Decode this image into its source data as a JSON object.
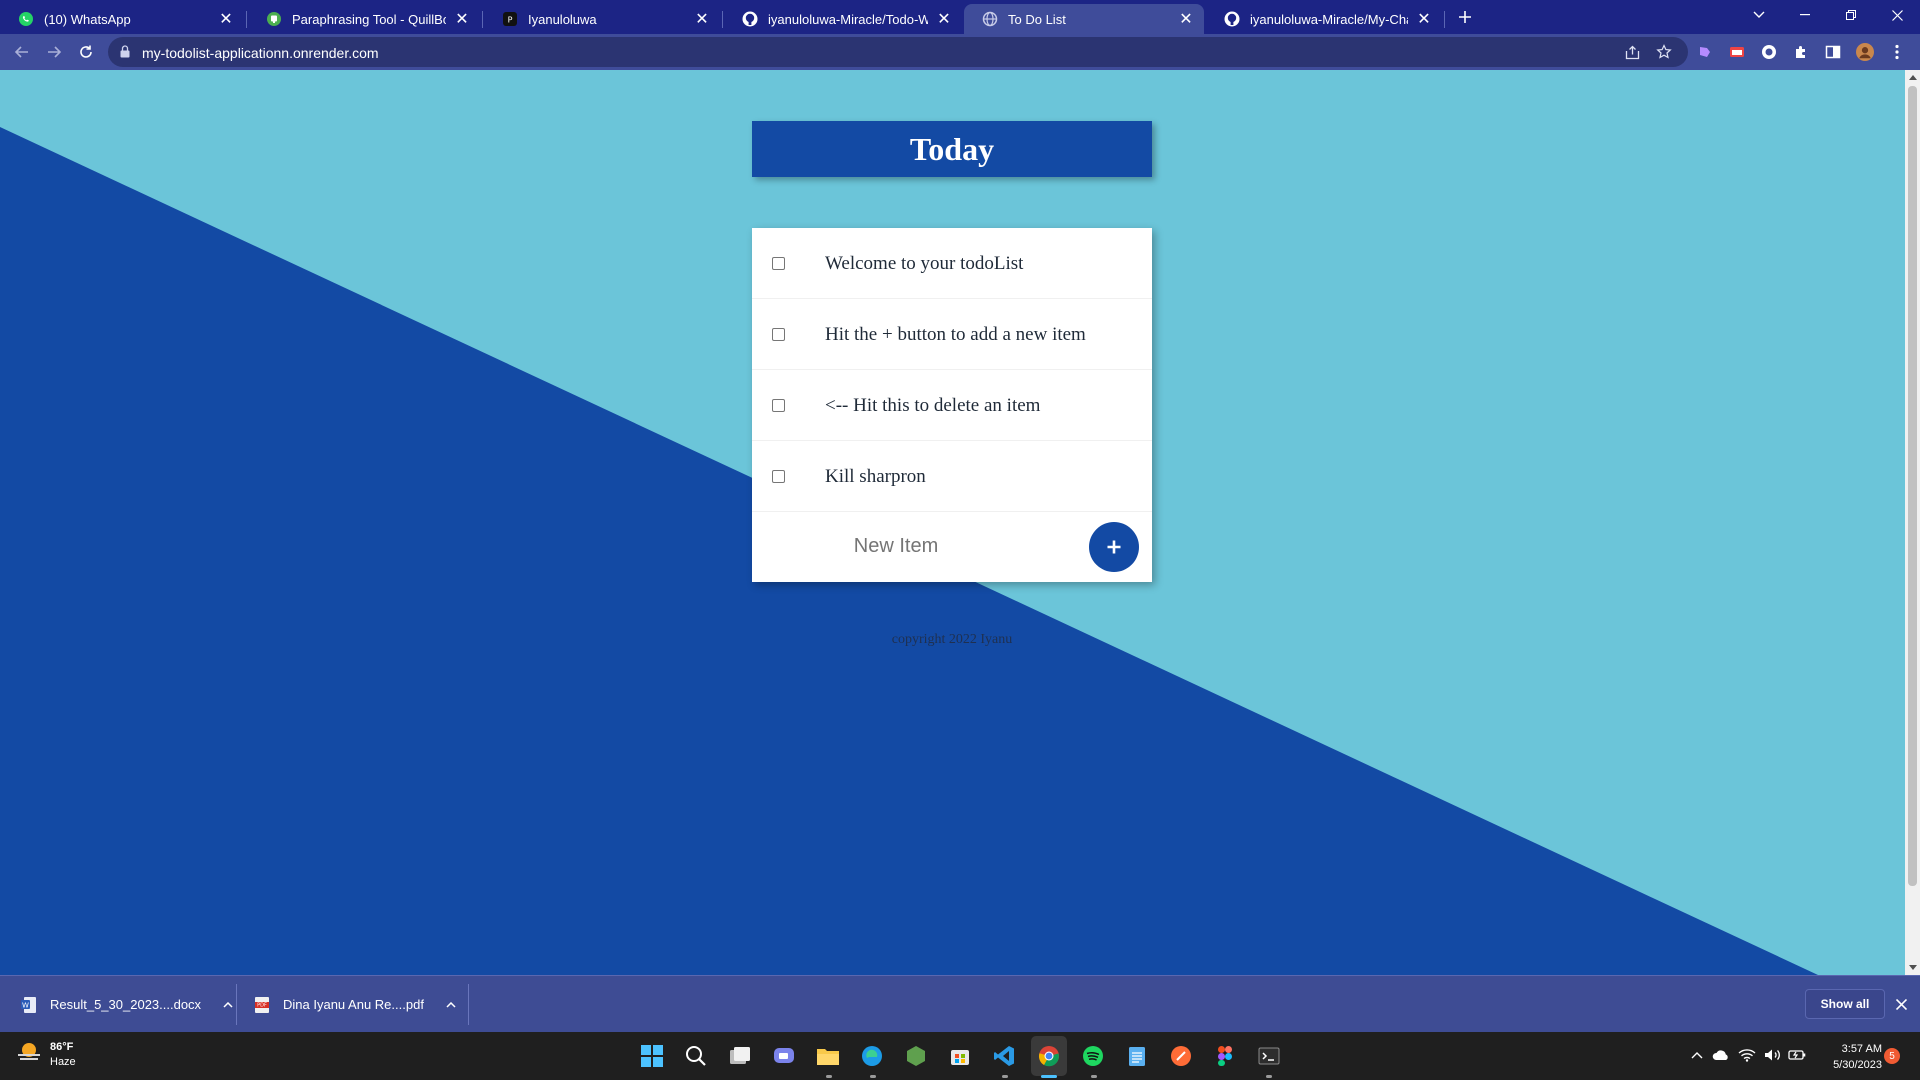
{
  "browser": {
    "tabs": [
      {
        "title": "(10) WhatsApp",
        "icon": "whatsapp-icon",
        "active": false
      },
      {
        "title": "Paraphrasing Tool - QuillBot AI",
        "icon": "quillbot-icon",
        "active": false
      },
      {
        "title": "Iyanuloluwa",
        "icon": "profile-site-icon",
        "active": false
      },
      {
        "title": "iyanuloluwa-Miracle/Todo-Weba",
        "icon": "github-icon",
        "active": false
      },
      {
        "title": "To Do List",
        "icon": "globe-icon",
        "active": true
      },
      {
        "title": "iyanuloluwa-Miracle/My-Chat-Ap",
        "icon": "github-icon",
        "active": false
      }
    ],
    "url": "my-todolist-applicationn.onrender.com",
    "accent_color": "#1c2485",
    "toolbar_color": "#3f4c9a"
  },
  "page": {
    "heading": "Today",
    "items": [
      {
        "text": "Welcome to your todoList",
        "checked": false
      },
      {
        "text": "Hit the + button to add a new item",
        "checked": false
      },
      {
        "text": "<-- Hit this to delete an item",
        "checked": false
      },
      {
        "text": "Kill sharpron",
        "checked": false
      }
    ],
    "new_item_placeholder": "New Item",
    "add_button_label": "+",
    "footer": "copyright 2022 Iyanu",
    "colors": {
      "light_bg": "#6bc5d9",
      "dark_bg": "#134aa4",
      "card": "#ffffff"
    }
  },
  "downloads": {
    "files": [
      {
        "name": "Result_5_30_2023....docx",
        "icon": "word-doc-icon"
      },
      {
        "name": "Dina Iyanu Anu Re....pdf",
        "icon": "pdf-icon"
      }
    ],
    "show_all_label": "Show all"
  },
  "taskbar": {
    "weather_temp": "86°F",
    "weather_desc": "Haze",
    "apps": [
      "windows-start-icon",
      "search-icon",
      "task-view-icon",
      "teams-chat-icon",
      "file-explorer-icon",
      "edge-icon",
      "node-icon",
      "microsoft-store-icon",
      "vscode-icon",
      "chrome-icon",
      "spotify-icon",
      "notepad-icon",
      "postman-icon",
      "figma-icon",
      "terminal-icon"
    ],
    "time": "3:57 AM",
    "date": "5/30/2023",
    "notification_count": "5"
  }
}
